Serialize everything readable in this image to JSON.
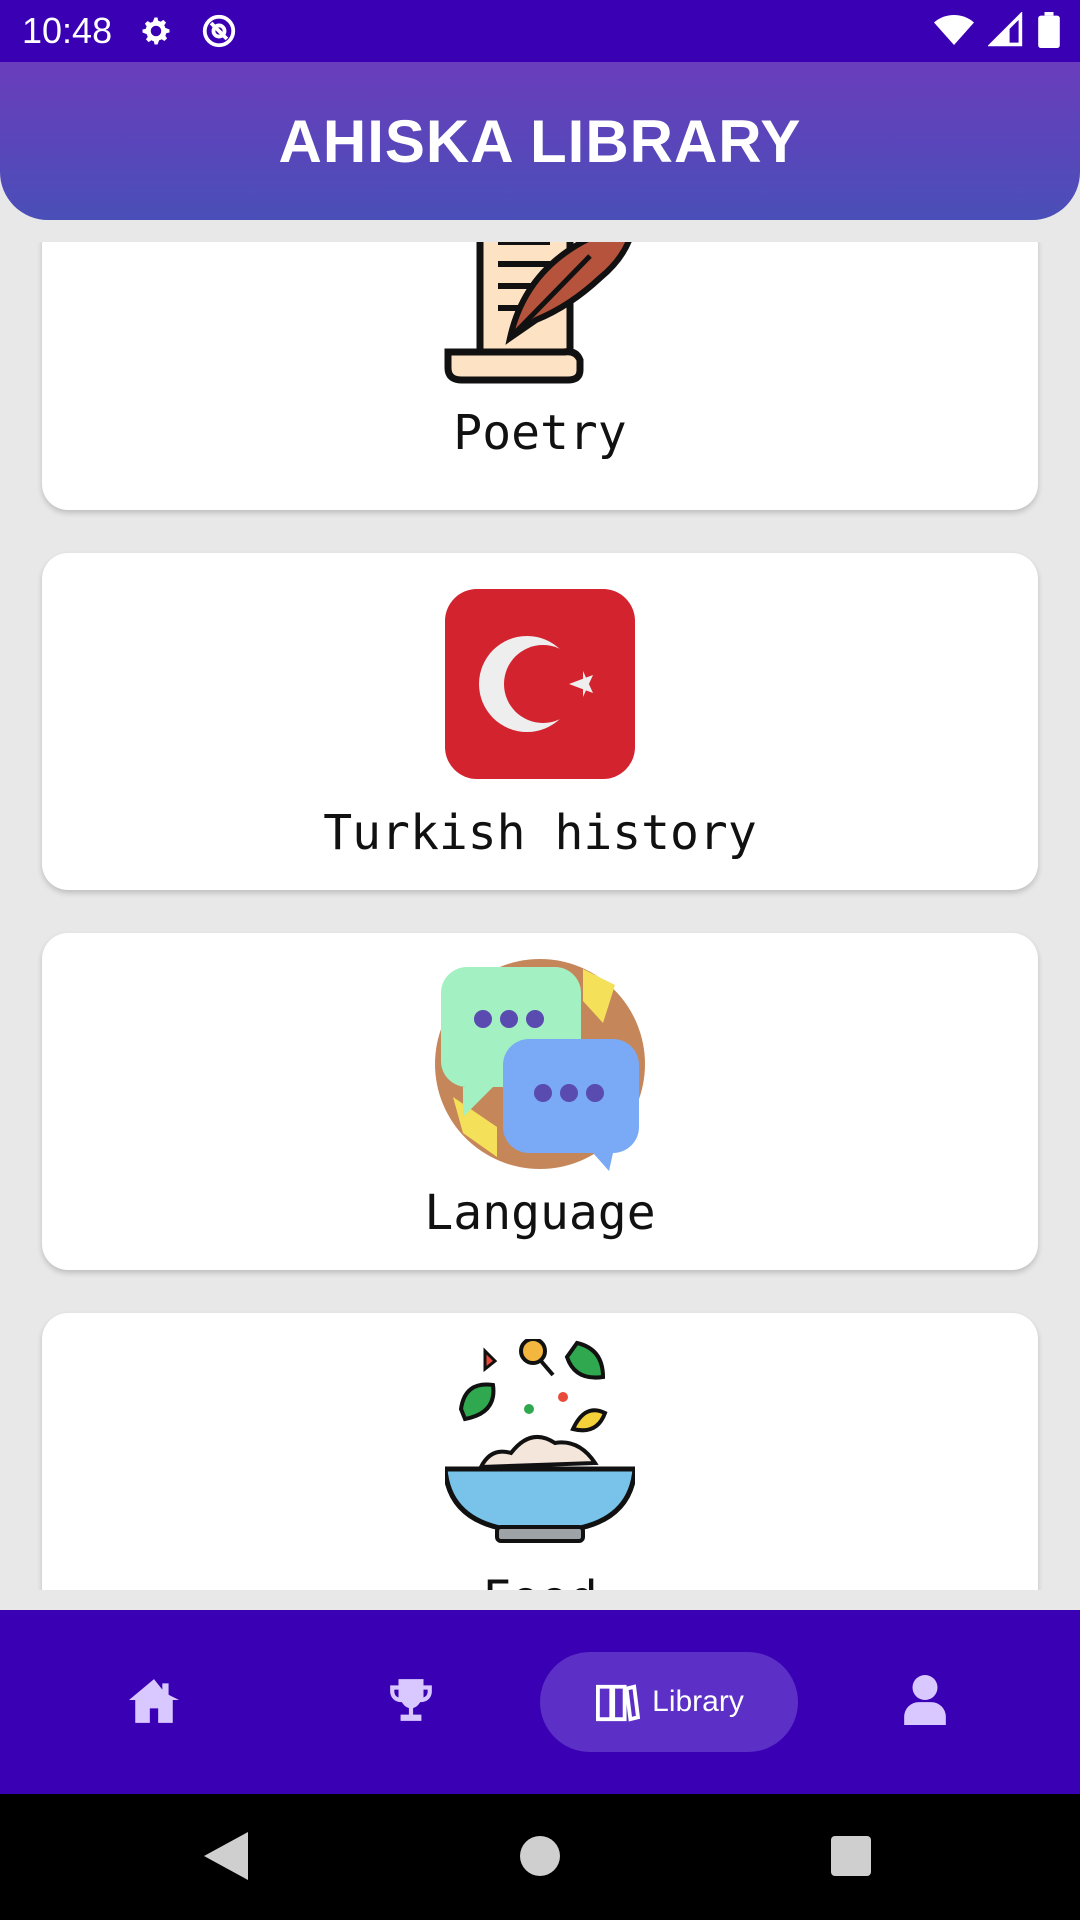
{
  "status_bar": {
    "time": "10:48"
  },
  "header": {
    "title": "AHISKA LIBRARY"
  },
  "categories": [
    {
      "label": "Poetry",
      "icon": "poetry-scroll-icon"
    },
    {
      "label": "Turkish history",
      "icon": "turkish-flag-icon"
    },
    {
      "label": "Language",
      "icon": "language-chat-icon"
    },
    {
      "label": "Food",
      "icon": "food-bowl-icon"
    }
  ],
  "bottom_nav": {
    "items": [
      {
        "icon": "home-icon"
      },
      {
        "icon": "trophy-icon"
      },
      {
        "icon": "library-icon",
        "label": "Library",
        "active": true
      },
      {
        "icon": "profile-icon"
      }
    ]
  },
  "colors": {
    "primary": "#3a00b4",
    "header_start": "#6a3dbc",
    "header_end": "#4a4fb8",
    "nav_active": "#5c2fc6",
    "nav_icon": "#d9c8ff"
  }
}
